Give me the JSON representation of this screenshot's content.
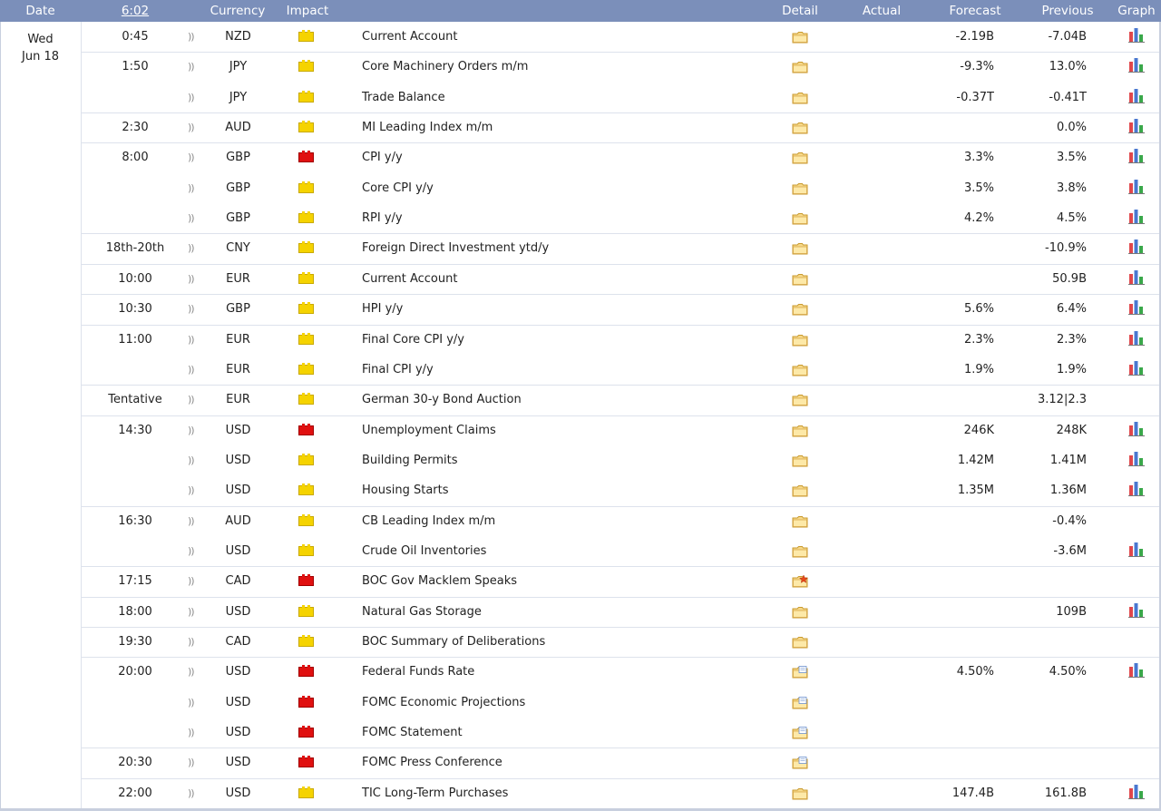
{
  "header": {
    "date": "Date",
    "time": "6:02",
    "currency": "Currency",
    "impact": "Impact",
    "detail": "Detail",
    "actual": "Actual",
    "forecast": "Forecast",
    "previous": "Previous",
    "graph": "Graph"
  },
  "day": {
    "weekday": "Wed",
    "date": "Jun 18"
  },
  "colors": {
    "header_bg": "#7b8fba",
    "impact_high": "#e01010",
    "impact_medium": "#f5d300"
  },
  "icons": {
    "sound": "sound-icon",
    "impact_high": "red-folder-impact-icon",
    "impact_medium": "yellow-folder-impact-icon",
    "detail": "folder-detail-icon",
    "detail_starred": "folder-star-detail-icon",
    "detail_doc": "folder-document-detail-icon",
    "graph": "bar-graph-icon"
  },
  "events": [
    {
      "time": "0:45",
      "currency": "NZD",
      "impact": "medium",
      "event": "Current Account",
      "detail": "normal",
      "forecast": "-2.19B",
      "previous": "-7.04B",
      "graph": true,
      "group_start": true
    },
    {
      "time": "1:50",
      "currency": "JPY",
      "impact": "medium",
      "event": "Core Machinery Orders m/m",
      "detail": "normal",
      "forecast": "-9.3%",
      "previous": "13.0%",
      "graph": true,
      "group_start": true
    },
    {
      "time": "",
      "currency": "JPY",
      "impact": "medium",
      "event": "Trade Balance",
      "detail": "normal",
      "forecast": "-0.37T",
      "previous": "-0.41T",
      "graph": true,
      "group_start": false
    },
    {
      "time": "2:30",
      "currency": "AUD",
      "impact": "medium",
      "event": "MI Leading Index m/m",
      "detail": "normal",
      "forecast": "",
      "previous": "0.0%",
      "graph": true,
      "group_start": true
    },
    {
      "time": "8:00",
      "currency": "GBP",
      "impact": "high",
      "event": "CPI y/y",
      "detail": "normal",
      "forecast": "3.3%",
      "previous": "3.5%",
      "graph": true,
      "group_start": true
    },
    {
      "time": "",
      "currency": "GBP",
      "impact": "medium",
      "event": "Core CPI y/y",
      "detail": "normal",
      "forecast": "3.5%",
      "previous": "3.8%",
      "graph": true,
      "group_start": false
    },
    {
      "time": "",
      "currency": "GBP",
      "impact": "medium",
      "event": "RPI y/y",
      "detail": "normal",
      "forecast": "4.2%",
      "previous": "4.5%",
      "graph": true,
      "group_start": false
    },
    {
      "time": "18th-20th",
      "currency": "CNY",
      "impact": "medium",
      "event": "Foreign Direct Investment ytd/y",
      "detail": "normal",
      "forecast": "",
      "previous": "-10.9%",
      "graph": true,
      "group_start": true
    },
    {
      "time": "10:00",
      "currency": "EUR",
      "impact": "medium",
      "event": "Current Account",
      "detail": "normal",
      "forecast": "",
      "previous": "50.9B",
      "graph": true,
      "group_start": true
    },
    {
      "time": "10:30",
      "currency": "GBP",
      "impact": "medium",
      "event": "HPI y/y",
      "detail": "normal",
      "forecast": "5.6%",
      "previous": "6.4%",
      "graph": true,
      "group_start": true
    },
    {
      "time": "11:00",
      "currency": "EUR",
      "impact": "medium",
      "event": "Final Core CPI y/y",
      "detail": "normal",
      "forecast": "2.3%",
      "previous": "2.3%",
      "graph": true,
      "group_start": true
    },
    {
      "time": "",
      "currency": "EUR",
      "impact": "medium",
      "event": "Final CPI y/y",
      "detail": "normal",
      "forecast": "1.9%",
      "previous": "1.9%",
      "graph": true,
      "group_start": false
    },
    {
      "time": "Tentative",
      "currency": "EUR",
      "impact": "medium",
      "event": "German 30-y Bond Auction",
      "detail": "normal",
      "forecast": "",
      "previous": "3.12|2.3",
      "graph": false,
      "group_start": true
    },
    {
      "time": "14:30",
      "currency": "USD",
      "impact": "high",
      "event": "Unemployment Claims",
      "detail": "normal",
      "forecast": "246K",
      "previous": "248K",
      "graph": true,
      "group_start": true
    },
    {
      "time": "",
      "currency": "USD",
      "impact": "medium",
      "event": "Building Permits",
      "detail": "normal",
      "forecast": "1.42M",
      "previous": "1.41M",
      "graph": true,
      "group_start": false
    },
    {
      "time": "",
      "currency": "USD",
      "impact": "medium",
      "event": "Housing Starts",
      "detail": "normal",
      "forecast": "1.35M",
      "previous": "1.36M",
      "graph": true,
      "group_start": false
    },
    {
      "time": "16:30",
      "currency": "AUD",
      "impact": "medium",
      "event": "CB Leading Index m/m",
      "detail": "normal",
      "forecast": "",
      "previous": "-0.4%",
      "graph": false,
      "group_start": true
    },
    {
      "time": "",
      "currency": "USD",
      "impact": "medium",
      "event": "Crude Oil Inventories",
      "detail": "normal",
      "forecast": "",
      "previous": "-3.6M",
      "graph": true,
      "group_start": false
    },
    {
      "time": "17:15",
      "currency": "CAD",
      "impact": "high",
      "event": "BOC Gov Macklem Speaks",
      "detail": "star",
      "forecast": "",
      "previous": "",
      "graph": false,
      "group_start": true
    },
    {
      "time": "18:00",
      "currency": "USD",
      "impact": "medium",
      "event": "Natural Gas Storage",
      "detail": "normal",
      "forecast": "",
      "previous": "109B",
      "graph": true,
      "group_start": true
    },
    {
      "time": "19:30",
      "currency": "CAD",
      "impact": "medium",
      "event": "BOC Summary of Deliberations",
      "detail": "normal",
      "forecast": "",
      "previous": "",
      "graph": false,
      "group_start": true
    },
    {
      "time": "20:00",
      "currency": "USD",
      "impact": "high",
      "event": "Federal Funds Rate",
      "detail": "doc",
      "forecast": "4.50%",
      "previous": "4.50%",
      "graph": true,
      "group_start": true
    },
    {
      "time": "",
      "currency": "USD",
      "impact": "high",
      "event": "FOMC Economic Projections",
      "detail": "doc",
      "forecast": "",
      "previous": "",
      "graph": false,
      "group_start": false
    },
    {
      "time": "",
      "currency": "USD",
      "impact": "high",
      "event": "FOMC Statement",
      "detail": "doc",
      "forecast": "",
      "previous": "",
      "graph": false,
      "group_start": false
    },
    {
      "time": "20:30",
      "currency": "USD",
      "impact": "high",
      "event": "FOMC Press Conference",
      "detail": "doc",
      "forecast": "",
      "previous": "",
      "graph": false,
      "group_start": true
    },
    {
      "time": "22:00",
      "currency": "USD",
      "impact": "medium",
      "event": "TIC Long-Term Purchases",
      "detail": "normal",
      "forecast": "147.4B",
      "previous": "161.8B",
      "graph": true,
      "group_start": true
    }
  ]
}
